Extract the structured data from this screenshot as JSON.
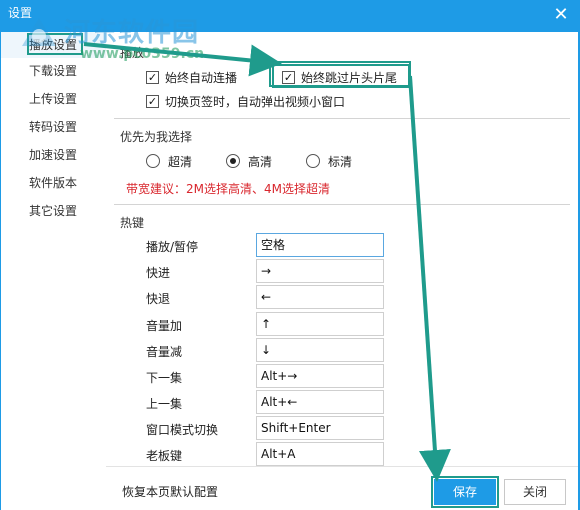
{
  "window": {
    "title": "设置",
    "close_glyph": "✕"
  },
  "watermark": {
    "text": "河东软件园",
    "url": "www.pc0359.cn"
  },
  "sidebar": {
    "items": [
      {
        "label": "播放设置",
        "active": true
      },
      {
        "label": "下载设置",
        "active": false
      },
      {
        "label": "上传设置",
        "active": false
      },
      {
        "label": "转码设置",
        "active": false
      },
      {
        "label": "加速设置",
        "active": false
      },
      {
        "label": "软件版本",
        "active": false
      },
      {
        "label": "其它设置",
        "active": false
      }
    ]
  },
  "playback": {
    "title": "播放",
    "autoplay": {
      "label": "始终自动连播",
      "checked": true
    },
    "skip_intro": {
      "label": "始终跳过片头片尾",
      "checked": true
    },
    "popup": {
      "label": "切换页签时，自动弹出视频小窗口",
      "checked": true
    }
  },
  "quality": {
    "title": "优先为我选择",
    "options": [
      {
        "label": "超清",
        "selected": false
      },
      {
        "label": "高清",
        "selected": true
      },
      {
        "label": "标清",
        "selected": false
      }
    ],
    "tip": "带宽建议：2M选择高清、4M选择超清"
  },
  "hotkeys": {
    "title": "热键",
    "rows": [
      {
        "label": "播放/暂停",
        "value": "空格"
      },
      {
        "label": "快进",
        "value": "→"
      },
      {
        "label": "快退",
        "value": "←"
      },
      {
        "label": "音量加",
        "value": "↑"
      },
      {
        "label": "音量减",
        "value": "↓"
      },
      {
        "label": "下一集",
        "value": "Alt+→"
      },
      {
        "label": "上一集",
        "value": "Alt+←"
      },
      {
        "label": "窗口模式切换",
        "value": "Shift+Enter"
      },
      {
        "label": "老板键",
        "value": "Alt+A"
      }
    ]
  },
  "footer": {
    "restore_label": "恢复本页默认配置",
    "save_label": "保存",
    "close_label": "关闭"
  },
  "colors": {
    "titlebar": "#1e9be6",
    "annotation": "#1f9b8c",
    "tip": "#d9272e",
    "save_button": "#1e9be6"
  },
  "icons": {
    "checkbox": "check-mark",
    "radio": "radio-dot",
    "close": "close-icon"
  }
}
